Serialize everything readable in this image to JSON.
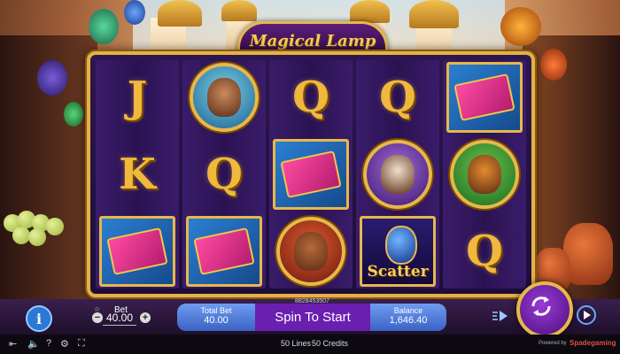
{
  "game": {
    "title": "Magical Lamp"
  },
  "reels": [
    [
      {
        "type": "letter",
        "symbol": "J"
      },
      {
        "type": "letter",
        "symbol": "K"
      },
      {
        "type": "carpet",
        "symbol": "magic-carpet"
      }
    ],
    [
      {
        "type": "round",
        "symbol": "jasmine"
      },
      {
        "type": "letter",
        "symbol": "Q"
      },
      {
        "type": "carpet",
        "symbol": "magic-carpet"
      }
    ],
    [
      {
        "type": "letter",
        "symbol": "Q"
      },
      {
        "type": "carpet",
        "symbol": "magic-carpet"
      },
      {
        "type": "round",
        "symbol": "vizier"
      }
    ],
    [
      {
        "type": "letter",
        "symbol": "Q"
      },
      {
        "type": "round",
        "symbol": "genie"
      },
      {
        "type": "scatter",
        "symbol": "Scatter"
      }
    ],
    [
      {
        "type": "carpet",
        "symbol": "magic-carpet"
      },
      {
        "type": "round",
        "symbol": "tiger"
      },
      {
        "type": "letter",
        "symbol": "Q"
      }
    ]
  ],
  "controls": {
    "info_label": "i",
    "bet_star": "☆",
    "bet_label": "Bet",
    "bet_value": "40.00",
    "minus": "−",
    "plus": "+",
    "total_bet_label": "Total Bet",
    "total_bet_value": "40.00",
    "session_id": "8828453507",
    "spin_label": "Spin To Start",
    "balance_label": "Balance",
    "balance_value": "1,646.40"
  },
  "footer": {
    "lines": "50 Lines",
    "credits": "50 Credits",
    "powered_by": "Powered by",
    "provider": "Spadegaming"
  },
  "colors": {
    "gold": "#e7b84a",
    "spin_purple": "#6a1fb0",
    "panel_blue": "#4a74d8"
  }
}
